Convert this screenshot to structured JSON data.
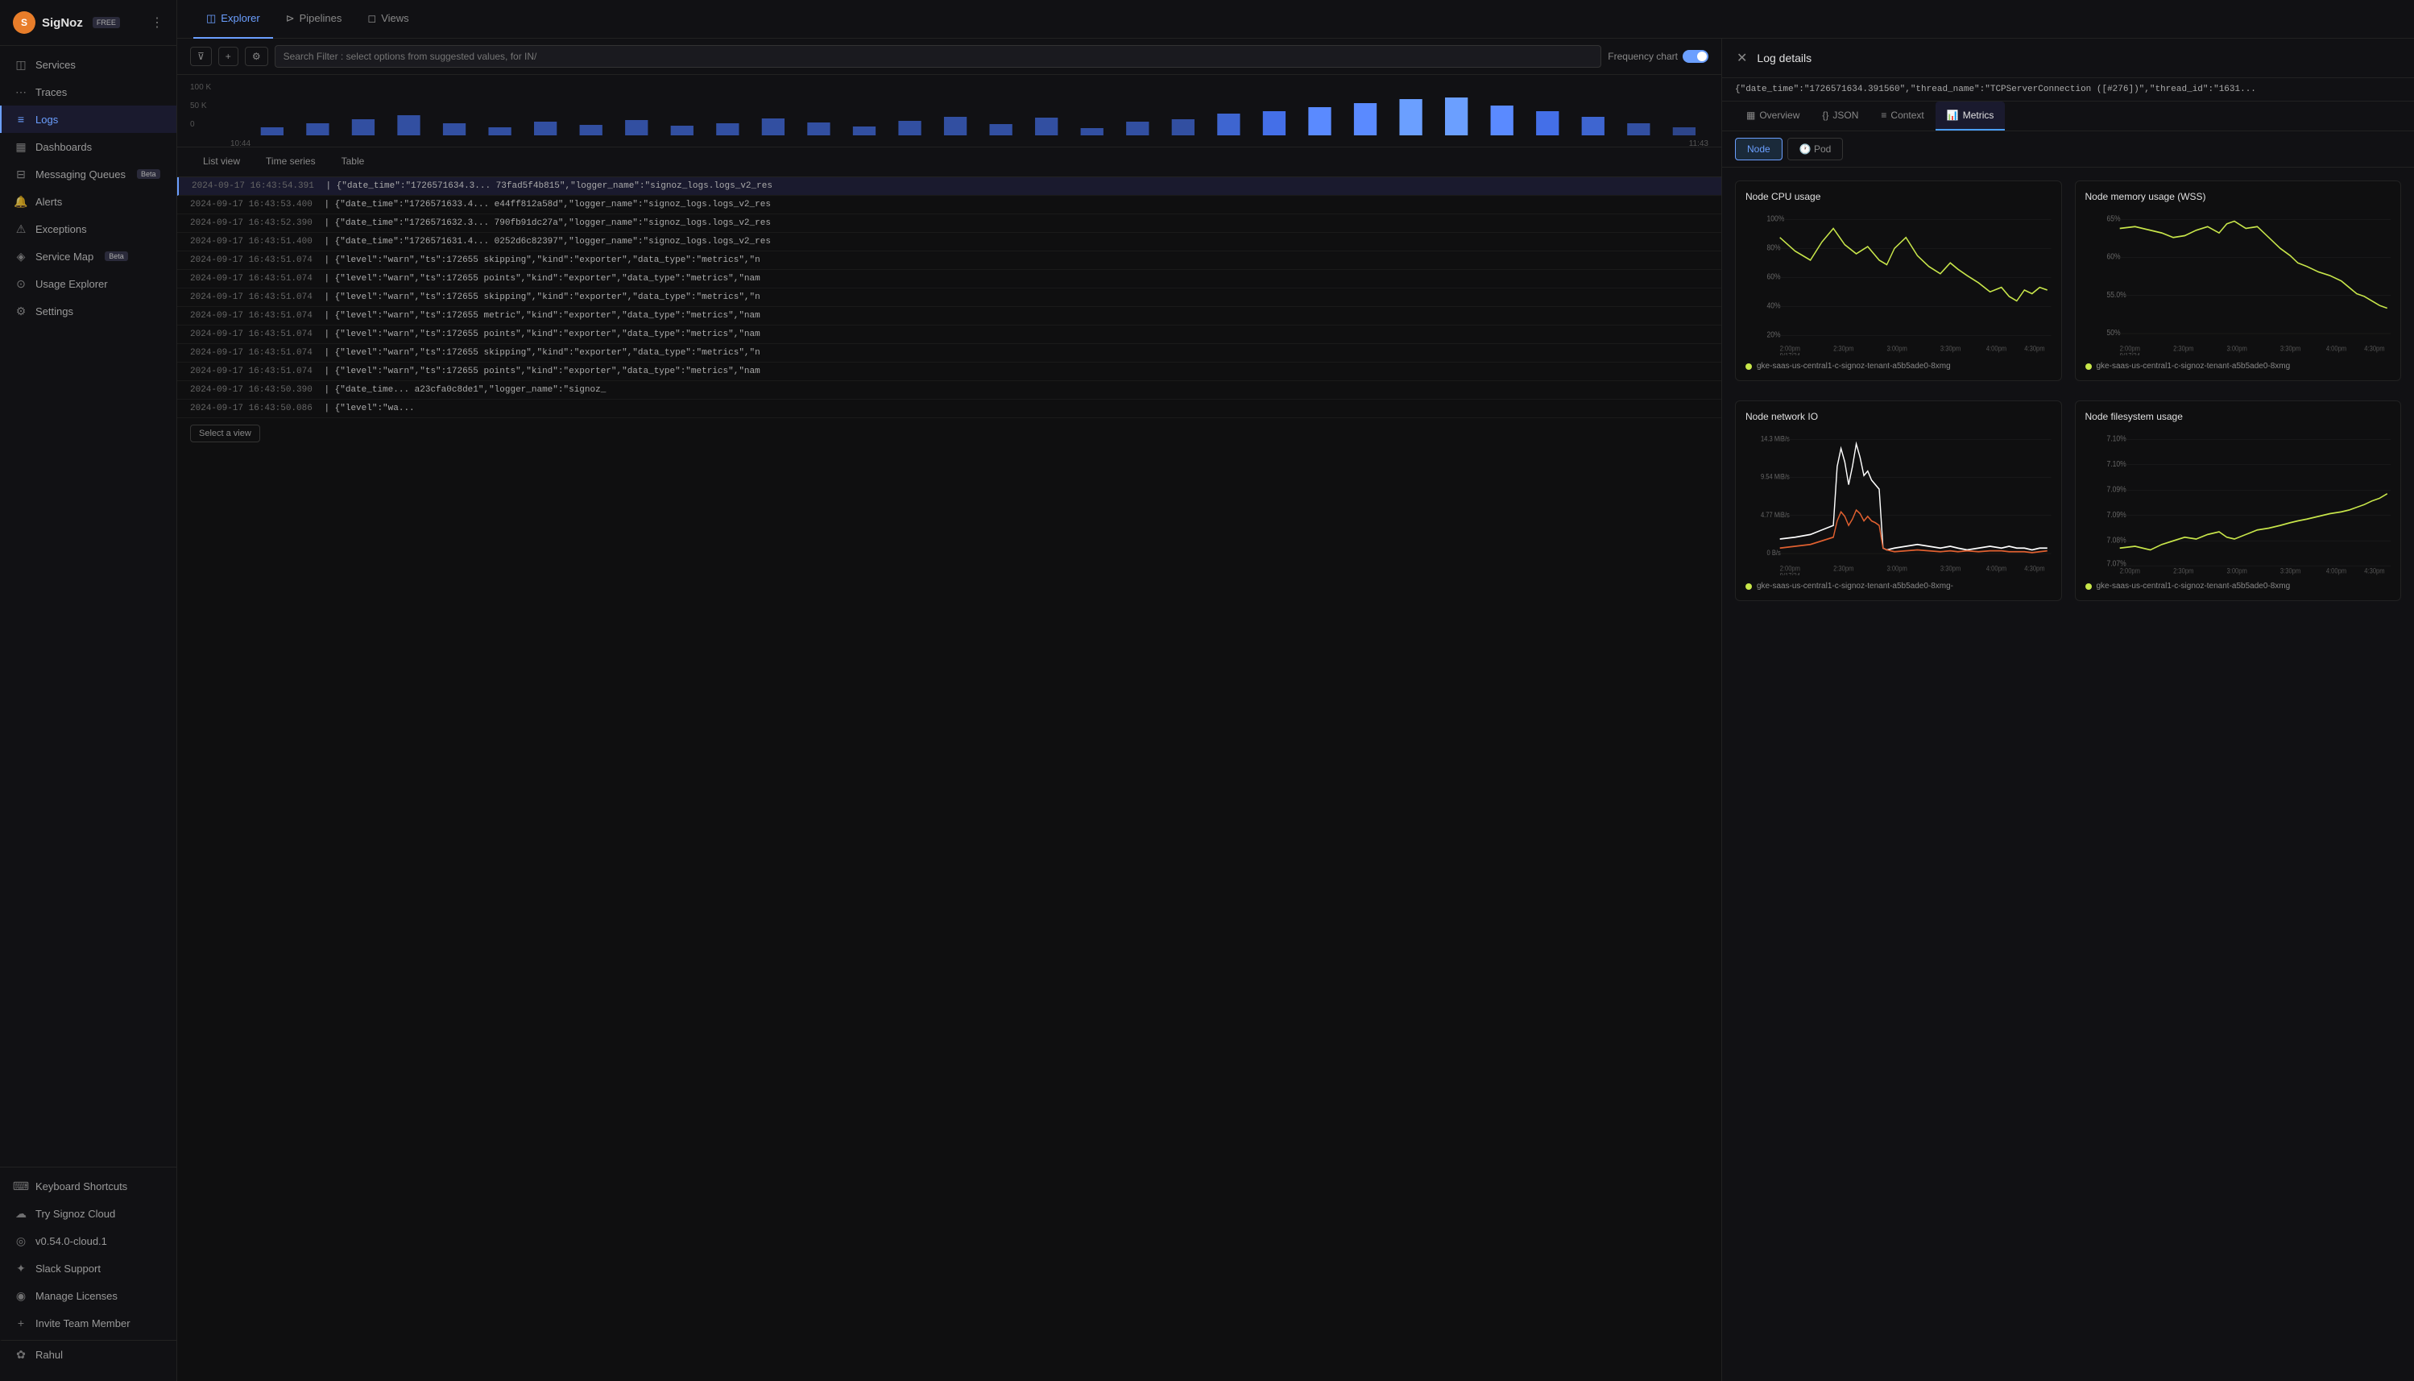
{
  "app": {
    "name": "SigNoz",
    "plan": "FREE",
    "user": "Rahul"
  },
  "sidebar": {
    "items": [
      {
        "id": "services",
        "label": "Services",
        "icon": "◫",
        "active": false
      },
      {
        "id": "traces",
        "label": "Traces",
        "icon": "⋯",
        "active": false
      },
      {
        "id": "logs",
        "label": "Logs",
        "icon": "≡",
        "active": true
      },
      {
        "id": "dashboards",
        "label": "Dashboards",
        "icon": "▦",
        "active": false
      },
      {
        "id": "messaging",
        "label": "Messaging Queues",
        "icon": "⊟",
        "badge": "Beta",
        "active": false
      },
      {
        "id": "alerts",
        "label": "Alerts",
        "icon": "🔔",
        "active": false
      },
      {
        "id": "exceptions",
        "label": "Exceptions",
        "icon": "⚠",
        "active": false
      },
      {
        "id": "servicemap",
        "label": "Service Map",
        "icon": "◈",
        "badge": "Beta",
        "active": false
      },
      {
        "id": "usage",
        "label": "Usage Explorer",
        "icon": "⊙",
        "active": false
      },
      {
        "id": "settings",
        "label": "Settings",
        "icon": "⚙",
        "active": false
      }
    ],
    "bottom_items": [
      {
        "id": "keyboard",
        "label": "Keyboard Shortcuts",
        "icon": "⌨"
      },
      {
        "id": "cloud",
        "label": "Try Signoz Cloud",
        "icon": "☁"
      },
      {
        "id": "version",
        "label": "v0.54.0-cloud.1",
        "icon": "◎"
      },
      {
        "id": "slack",
        "label": "Slack Support",
        "icon": "✦"
      },
      {
        "id": "licenses",
        "label": "Manage Licenses",
        "icon": "◉"
      },
      {
        "id": "invite",
        "label": "Invite Team Member",
        "icon": "+"
      }
    ]
  },
  "top_nav": {
    "tabs": [
      {
        "id": "explorer",
        "label": "Explorer",
        "active": true,
        "icon": "◫"
      },
      {
        "id": "pipelines",
        "label": "Pipelines",
        "active": false,
        "icon": "⊳"
      },
      {
        "id": "views",
        "label": "Views",
        "active": false,
        "icon": "◻"
      }
    ]
  },
  "toolbar": {
    "search_placeholder": "Search Filter : select options from suggested values, for IN/",
    "frequency_chart_label": "Frequency chart"
  },
  "chart": {
    "y_labels": [
      "100 K",
      "50 K",
      "0"
    ],
    "x_labels": [
      "10:44",
      "11:43"
    ]
  },
  "view_tabs": [
    {
      "id": "list",
      "label": "List view",
      "active": false
    },
    {
      "id": "timeseries",
      "label": "Time series",
      "active": false
    },
    {
      "id": "table",
      "label": "Table",
      "active": false
    }
  ],
  "log_rows": [
    {
      "time": "2024-09-17 16:43:54.391",
      "content": "| {\"date_time\":\"1726571634.3... 73fad5f4b815\",\"logger_name\":\"signoz_logs.logs_v2_res"
    },
    {
      "time": "2024-09-17 16:43:53.400",
      "content": "| {\"date_time\":\"1726571633.4... e44ff812a58d\",\"logger_name\":\"signoz_logs.logs_v2_res"
    },
    {
      "time": "2024-09-17 16:43:52.390",
      "content": "| {\"date_time\":\"1726571632.3... 790fb91dc27a\",\"logger_name\":\"signoz_logs.logs_v2_res"
    },
    {
      "time": "2024-09-17 16:43:51.400",
      "content": "| {\"date_time\":\"1726571631.4... 0252d6c82397\",\"logger_name\":\"signoz_logs.logs_v2_res"
    },
    {
      "time": "2024-09-17 16:43:51.074",
      "content": "| {\"level\":\"warn\",\"ts\":172655 skipping\",\"kind\":\"exporter\",\"data_type\":\"metrics\",\"n"
    },
    {
      "time": "2024-09-17 16:43:51.074",
      "content": "| {\"level\":\"warn\",\"ts\":172655 points\",\"kind\":\"exporter\",\"data_type\":\"metrics\",\"nam"
    },
    {
      "time": "2024-09-17 16:43:51.074",
      "content": "| {\"level\":\"warn\",\"ts\":172655 skipping\",\"kind\":\"exporter\",\"data_type\":\"metrics\",\"n"
    },
    {
      "time": "2024-09-17 16:43:51.074",
      "content": "| {\"level\":\"warn\",\"ts\":172655 metric\",\"kind\":\"exporter\",\"data_type\":\"metrics\",\"nam"
    },
    {
      "time": "2024-09-17 16:43:51.074",
      "content": "| {\"level\":\"warn\",\"ts\":172655 points\",\"kind\":\"exporter\",\"data_type\":\"metrics\",\"nam"
    },
    {
      "time": "2024-09-17 16:43:51.074",
      "content": "| {\"level\":\"warn\",\"ts\":172655 skipping\",\"kind\":\"exporter\",\"data_type\":\"metrics\",\"n"
    },
    {
      "time": "2024-09-17 16:43:51.074",
      "content": "| {\"level\":\"warn\",\"ts\":172655 points\",\"kind\":\"exporter\",\"data_type\":\"metrics\",\"nam"
    },
    {
      "time": "2024-09-17 16:43:50.390",
      "content": "| {\"date_time... a23cfa0c8de1\",\"logger_name\":\"signoz_"
    },
    {
      "time": "2024-09-17 16:43:50.086",
      "content": "| {\"level\":\"wa..."
    }
  ],
  "log_details": {
    "title": "Log details",
    "log_line": "{\"date_time\":\"1726571634.391560\",\"thread_name\":\"TCPServerConnection ([#276])\",\"thread_id\":\"1631...",
    "nav_tabs": [
      {
        "id": "overview",
        "label": "Overview",
        "icon": "▦",
        "active": false
      },
      {
        "id": "json",
        "label": "JSON",
        "icon": "{}",
        "active": false
      },
      {
        "id": "context",
        "label": "Context",
        "icon": "≡",
        "active": false
      },
      {
        "id": "metrics",
        "label": "Metrics",
        "icon": "📊",
        "active": true
      }
    ],
    "sub_tabs": [
      {
        "id": "node",
        "label": "Node",
        "active": true
      },
      {
        "id": "pod",
        "label": "Pod",
        "active": false
      }
    ],
    "metrics": {
      "node_cpu": {
        "title": "Node CPU usage",
        "y_labels": [
          "100%",
          "80%",
          "60%",
          "40%",
          "20%"
        ],
        "x_labels": [
          "2:00pm\n9/17/24",
          "2:30pm",
          "3:00pm",
          "3:30pm",
          "4:00pm",
          "4:30pm"
        ],
        "legend": "gke-saas-us-central1-c-signoz-tenant-a5b5ade0-8xmg",
        "legend_color": "#c8e64a"
      },
      "node_memory": {
        "title": "Node memory usage (WSS)",
        "y_labels": [
          "65%",
          "60%",
          "55.0%",
          "50%"
        ],
        "x_labels": [
          "2:00pm\n9/17/24",
          "2:30pm",
          "3:00pm",
          "3:30pm",
          "4:00pm",
          "4:30pm"
        ],
        "legend": "gke-saas-us-central1-c-signoz-tenant-a5b5ade0-8xmg",
        "legend_color": "#c8e64a"
      },
      "node_network": {
        "title": "Node network IO",
        "y_labels": [
          "14.3 MiB/s",
          "9.54 MiB/s",
          "4.77 MiB/s",
          "0 B/s"
        ],
        "x_labels": [
          "2:00pm\n9/17/24",
          "2:30pm",
          "3:00pm",
          "3:30pm",
          "4:00pm",
          "4:30pm"
        ],
        "legend": "gke-saas-us-central1-c-signoz-tenant-a5b5ade0-8xmg-",
        "legend_color": "#c8e64a"
      },
      "node_filesystem": {
        "title": "Node filesystem usage",
        "y_labels": [
          "7.10%",
          "7.10%",
          "7.09%",
          "7.09%",
          "7.08%",
          "7.07%"
        ],
        "x_labels": [
          "2:00pm\n9/17/24",
          "2:30pm",
          "3:00pm",
          "3:30pm",
          "4:00pm",
          "4:30pm"
        ],
        "legend": "gke-saas-us-central1-c-signoz-tenant-a5b5ade0-8xmg",
        "legend_color": "#c8e64a"
      }
    }
  }
}
